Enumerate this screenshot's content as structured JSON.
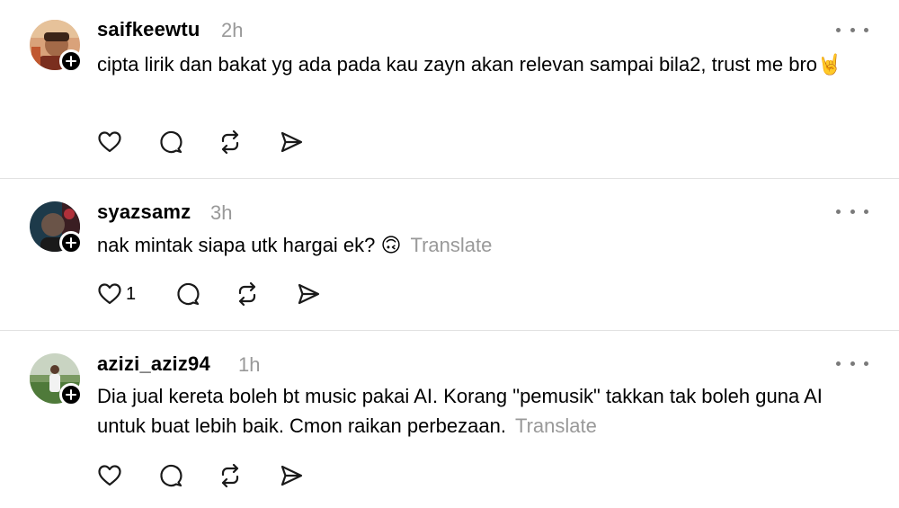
{
  "posts": [
    {
      "username": "saifkeewtu",
      "time": "2h",
      "text": "cipta lirik dan bakat yg ada pada kau zayn akan relevan sampai bila2, trust me bro",
      "emoji": "🤘",
      "translate": "",
      "like_count": ""
    },
    {
      "username": "syazsamz",
      "time": "3h",
      "text": "nak mintak siapa utk hargai ek? ",
      "emoji": "🙃",
      "translate": "Translate",
      "like_count": "1"
    },
    {
      "username": "azizi_aziz94",
      "time": "1h",
      "text": "Dia jual kereta boleh bt music pakai AI. Korang \"pemusik\" takkan tak boleh guna AI untuk buat lebih baik. Cmon raikan perbezaan.",
      "emoji": "",
      "translate": "Translate",
      "like_count": ""
    }
  ],
  "icons": {
    "like": "heart-icon",
    "reply": "comment-icon",
    "repost": "repost-icon",
    "share": "send-icon",
    "more": "more-icon",
    "follow": "plus-icon"
  },
  "colors": {
    "text": "#000000",
    "muted": "#999999",
    "divider": "#e2e2e2",
    "icon": "#1a1a1a"
  }
}
